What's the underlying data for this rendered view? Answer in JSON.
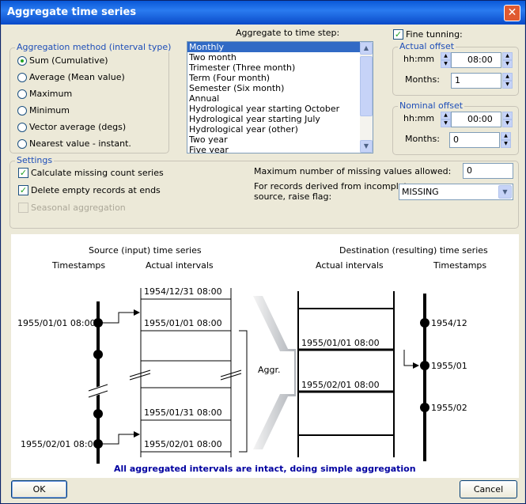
{
  "window": {
    "title": "Aggregate time series"
  },
  "aggregation_method": {
    "legend": "Aggregation method (interval type)",
    "options": [
      {
        "label": "Sum (Cumulative)",
        "selected": true
      },
      {
        "label": "Average (Mean value)",
        "selected": false
      },
      {
        "label": "Maximum",
        "selected": false
      },
      {
        "label": "Minimum",
        "selected": false
      },
      {
        "label": "Vector average (degs)",
        "selected": false
      },
      {
        "label": "Nearest value - instant.",
        "selected": false
      }
    ]
  },
  "time_step": {
    "label": "Aggregate to time step:",
    "items": [
      "Monthly",
      "Two month",
      "Trimester (Three month)",
      "Term (Four month)",
      "Semester (Six month)",
      "Annual",
      "Hydrological year starting October",
      "Hydrological year starting July",
      "Hydrological year (other)",
      "Two year",
      "Five year"
    ],
    "selected": "Monthly"
  },
  "fine_tuning": {
    "label": "Fine tunning:",
    "checked": true,
    "actual_offset": {
      "legend": "Actual offset",
      "hhmm_label": "hh:mm",
      "hhmm_value": "08:00",
      "months_label": "Months:",
      "months_value": "1"
    },
    "nominal_offset": {
      "legend": "Nominal offset",
      "hhmm_label": "hh:mm",
      "hhmm_value": "00:00",
      "months_label": "Months:",
      "months_value": "0"
    }
  },
  "settings": {
    "legend": "Settings",
    "calc_missing": {
      "label": "Calculate missing count series",
      "checked": true
    },
    "delete_empty": {
      "label": "Delete empty records at ends",
      "checked": true
    },
    "seasonal": {
      "label": "Seasonal aggregation",
      "checked": false
    },
    "max_missing_label": "Maximum number of missing values allowed:",
    "max_missing_value": "0",
    "flag_label_1": "For records derived from incomplete",
    "flag_label_2": "source, raise flag:",
    "flag_value": "MISSING"
  },
  "diagram": {
    "source_title": "Source (input) time series",
    "dest_title": "Destination (resulting) time series",
    "timestamps": "Timestamps",
    "actual_intervals": "Actual intervals",
    "src_labels": [
      "1954/12/31 08:00",
      "1955/01/01 08:00",
      "1955/01/31 08:00",
      "1955/02/01 08:00"
    ],
    "src_timestamps": [
      "1955/01/01 08:00",
      "1955/02/01 08:00"
    ],
    "dst_labels": [
      "1955/01/01 08:00",
      "1955/02/01 08:00"
    ],
    "dst_timestamps": [
      "1954/12",
      "1955/01",
      "1955/02"
    ],
    "aggr": "Aggr.",
    "message": "All aggregated intervals are intact, doing simple aggregation"
  },
  "buttons": {
    "ok": "OK",
    "cancel": "Cancel"
  },
  "colors": {
    "title_bar": "#0a58d8",
    "legend": "#1e4eb8",
    "message": "#0000a0"
  }
}
